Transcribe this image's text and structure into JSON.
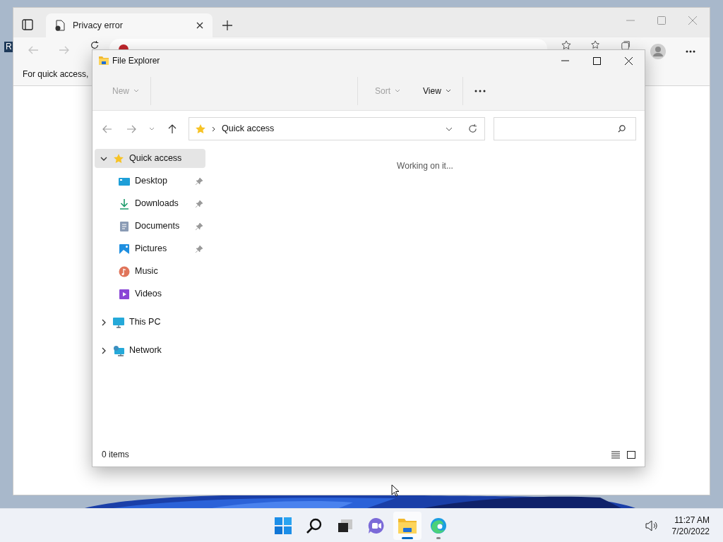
{
  "desktop": {
    "icon_label": "R"
  },
  "browser": {
    "tabs": [
      {
        "title": "Privacy error",
        "selected": true
      }
    ],
    "favorites_hint": "For quick access,"
  },
  "explorer": {
    "title": "File Explorer",
    "commands": [
      {
        "label": "New",
        "disabled": true
      },
      {
        "label": "Sort",
        "disabled": true
      },
      {
        "label": "View",
        "disabled": false
      }
    ],
    "address": "Quick access",
    "status_message": "Working on it...",
    "nav": [
      {
        "label": "Quick access",
        "kind": "star",
        "expanded": true,
        "selected": true,
        "children": [
          {
            "label": "Desktop",
            "kind": "desktop",
            "pinned": true,
            "selected": false
          },
          {
            "label": "Downloads",
            "kind": "download",
            "pinned": true,
            "selected": false
          },
          {
            "label": "Documents",
            "kind": "documents",
            "pinned": true,
            "selected": false
          },
          {
            "label": "Pictures",
            "kind": "pictures",
            "pinned": true,
            "selected": false
          },
          {
            "label": "Music",
            "kind": "music",
            "pinned": false,
            "selected": false
          },
          {
            "label": "Videos",
            "kind": "videos",
            "pinned": false,
            "selected": false
          }
        ]
      },
      {
        "label": "This PC",
        "kind": "pc",
        "expanded": false,
        "selected": false
      },
      {
        "label": "Network",
        "kind": "network",
        "expanded": false,
        "selected": false
      }
    ],
    "status_bar": "0 items"
  },
  "taskbar": {
    "apps": [
      {
        "kind": "start",
        "active": false,
        "running": false
      },
      {
        "kind": "search",
        "active": false,
        "running": false
      },
      {
        "kind": "taskview",
        "active": false,
        "running": false
      },
      {
        "kind": "chat",
        "active": false,
        "running": false
      },
      {
        "kind": "explorer",
        "active": true,
        "running": true
      },
      {
        "kind": "edge",
        "active": false,
        "running": true
      }
    ],
    "time": "11:27 AM",
    "date": "7/20/2022"
  }
}
